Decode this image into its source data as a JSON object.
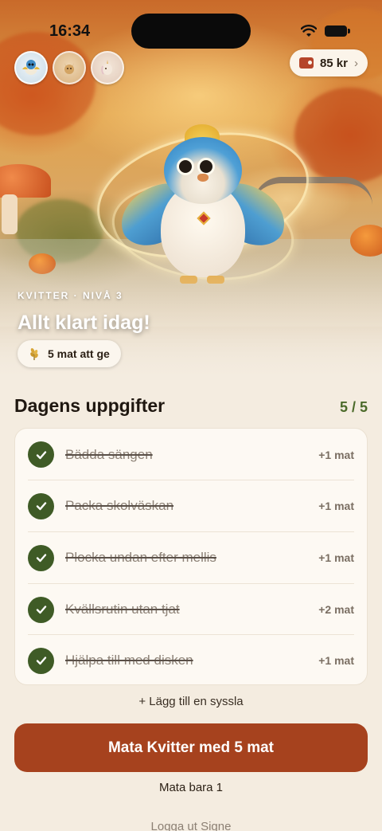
{
  "status_bar": {
    "time": "16:34"
  },
  "pets": [
    {
      "name": "Kvitter",
      "icon": "bird-avatar-icon",
      "active": true
    },
    {
      "name": "",
      "icon": "cat-avatar-icon",
      "active": false
    },
    {
      "name": "",
      "icon": "unicorn-avatar-icon",
      "active": false
    }
  ],
  "wallet": {
    "amount": "85 kr",
    "icon": "wallet-icon"
  },
  "hero": {
    "meta": "KVITTER · NIVÅ 3",
    "title": "Allt klart idag!",
    "food_pill": "5 mat att ge",
    "food_icon": "wheat-icon"
  },
  "tasks": {
    "title": "Dagens uppgifter",
    "count": "5 / 5",
    "items": [
      {
        "label": "Bädda sängen",
        "reward": "+1 mat",
        "done": true
      },
      {
        "label": "Packa skolväskan",
        "reward": "+1 mat",
        "done": true
      },
      {
        "label": "Plocka undan efter mellis",
        "reward": "+1 mat",
        "done": true
      },
      {
        "label": "Kvällsrutin utan tjat",
        "reward": "+2 mat",
        "done": true
      },
      {
        "label": "Hjälpa till med disken",
        "reward": "+1 mat",
        "done": true
      }
    ],
    "add_label": "+ Lägg till en syssla"
  },
  "actions": {
    "feed_label": "Mata Kvitter med 5 mat",
    "feed_one_label": "Mata bara 1",
    "logout_label": "Logga ut Signe"
  },
  "colors": {
    "accent": "#a6421e",
    "check": "#3f5b26",
    "background": "#f4ece0"
  }
}
